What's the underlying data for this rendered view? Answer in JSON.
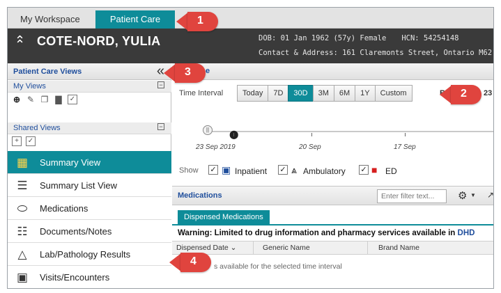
{
  "tabs": [
    {
      "label": "My Workspace"
    },
    {
      "label": "Patient Care",
      "active": true
    }
  ],
  "patient": {
    "collapse_icon": "double-chevron-up-icon",
    "name": "COTE-NORD, YULIA",
    "dob_text": "DOB: 01 Jan 1962 (57y) Female",
    "hcn_text": "HCN: 54254148",
    "contact_text": "Contact & Address: 161 Claremonts Street, Ontario M62"
  },
  "sidebar": {
    "title": "Patient Care Views",
    "collapse_icon": "double-chevron-left-icon",
    "my_views_label": "My Views",
    "shared_views_label": "Shared Views",
    "my_views_tools": [
      "add-icon",
      "edit-icon",
      "copy-icon",
      "delete-icon",
      "checkbox-icon"
    ],
    "shared_views_tools": [
      "add-icon",
      "checkbox-icon"
    ],
    "items": [
      {
        "label": "Summary View",
        "icon": "grid-check-icon",
        "active": true
      },
      {
        "label": "Summary List View",
        "icon": "list-icon"
      },
      {
        "label": "Medications",
        "icon": "pills-icon"
      },
      {
        "label": "Documents/Notes",
        "icon": "document-icon"
      },
      {
        "label": "Lab/Pathology Results",
        "icon": "flask-icon"
      },
      {
        "label": "Visits/Encounters",
        "icon": "building-icon"
      }
    ]
  },
  "main": {
    "title": "e",
    "time_interval_label": "Time Interval",
    "time_buttons": [
      "Today",
      "7D",
      "30D",
      "3M",
      "6M",
      "1Y",
      "Custom"
    ],
    "active_time_button": "30D",
    "time_extra_left": "B",
    "time_extra_right": "23",
    "timeline": {
      "dates": [
        "23 Sep 2019",
        "20 Sep",
        "17 Sep"
      ]
    },
    "show": {
      "label": "Show",
      "options": [
        {
          "label": "Inpatient",
          "icon": "hospital-icon",
          "checked": true
        },
        {
          "label": "Ambulatory",
          "icon": "walking-person-icon",
          "checked": true
        },
        {
          "label": "ED",
          "icon": "ambulance-icon",
          "checked": true
        }
      ]
    },
    "medications": {
      "title": "Medications",
      "filter_placeholder": "Enter filter text...",
      "tab_label": "Dispensed Medications",
      "warning": "Warning: Limited to drug information and pharmacy services available in ",
      "warning_link": "DHD",
      "columns": [
        "Dispensed Date",
        "Generic Name",
        "Brand Name"
      ],
      "empty_text": "s available for the selected time interval"
    }
  },
  "callouts": [
    "1",
    "2",
    "3",
    "4"
  ],
  "colors": {
    "accent": "#0e8c99",
    "header_bg": "#3a3a3a",
    "link": "#1f4e9c",
    "callout": "#e0443e"
  }
}
